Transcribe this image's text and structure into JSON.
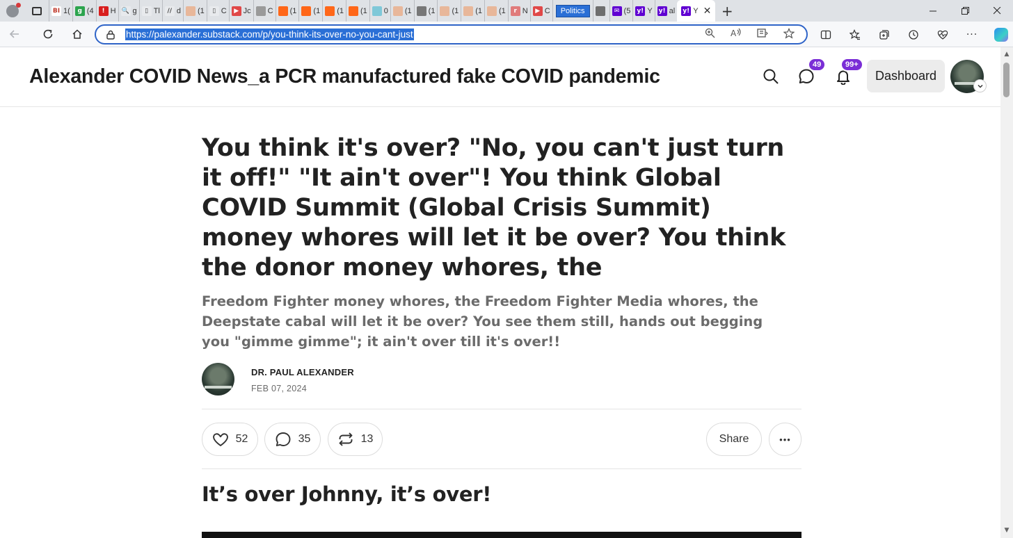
{
  "browser": {
    "tabs": [
      {
        "short": "1(",
        "fav_color": "#ffffff",
        "fav_text": "BI",
        "fav_fg": "#c0392b"
      },
      {
        "short": "(4",
        "fav_color": "#2ca44e",
        "fav_text": "g",
        "fav_fg": "#ffffff"
      },
      {
        "short": "H",
        "fav_color": "#d81e1e",
        "fav_text": "!",
        "fav_fg": "#ffffff"
      },
      {
        "short": "g",
        "fav_color": "#e8eaed",
        "fav_text": "🔍",
        "fav_fg": "#444444"
      },
      {
        "short": "Tl",
        "fav_color": "#e8eaed",
        "fav_text": "▯",
        "fav_fg": "#444444"
      },
      {
        "short": "d",
        "fav_color": "#e8eaed",
        "fav_text": "//",
        "fav_fg": "#444444"
      },
      {
        "short": "(1",
        "fav_color": "#e8b79a",
        "fav_text": "",
        "fav_fg": "#ffffff"
      },
      {
        "short": "C",
        "fav_color": "#e8eaed",
        "fav_text": "▯",
        "fav_fg": "#444444"
      },
      {
        "short": "Jc",
        "fav_color": "#e04848",
        "fav_text": "▶",
        "fav_fg": "#ffffff"
      },
      {
        "short": "C",
        "fav_color": "#9a9a9a",
        "fav_text": "",
        "fav_fg": "#ffffff"
      },
      {
        "short": "(1",
        "fav_color": "#ff6719",
        "fav_text": "",
        "fav_fg": "#ffffff"
      },
      {
        "short": "(1",
        "fav_color": "#ff6719",
        "fav_text": "",
        "fav_fg": "#ffffff"
      },
      {
        "short": "(1",
        "fav_color": "#ff6719",
        "fav_text": "",
        "fav_fg": "#ffffff"
      },
      {
        "short": "(1",
        "fav_color": "#ff6719",
        "fav_text": "",
        "fav_fg": "#ffffff"
      },
      {
        "short": "0",
        "fav_color": "#7fc8d8",
        "fav_text": "",
        "fav_fg": "#ffffff"
      },
      {
        "short": "(1",
        "fav_color": "#e8b79a",
        "fav_text": "",
        "fav_fg": "#ffffff"
      },
      {
        "short": "(1",
        "fav_color": "#777777",
        "fav_text": "",
        "fav_fg": "#ffffff"
      },
      {
        "short": "(1",
        "fav_color": "#e8b79a",
        "fav_text": "",
        "fav_fg": "#ffffff"
      },
      {
        "short": "(1",
        "fav_color": "#e8b79a",
        "fav_text": "",
        "fav_fg": "#ffffff"
      },
      {
        "short": "(1",
        "fav_color": "#e8b79a",
        "fav_text": "",
        "fav_fg": "#ffffff"
      },
      {
        "short": "N",
        "fav_color": "#e07b7b",
        "fav_text": "r",
        "fav_fg": "#ffffff"
      },
      {
        "short": "C",
        "fav_color": "#e04848",
        "fav_text": "▶",
        "fav_fg": "#ffffff"
      }
    ],
    "politics_tab": "Politics",
    "tabs_after": [
      {
        "short": "",
        "fav_color": "#6e6e6e",
        "fav_text": "",
        "fav_fg": "#ffffff"
      },
      {
        "short": "(5",
        "fav_color": "#6001d2",
        "fav_text": "✉",
        "fav_fg": "#ffffff"
      },
      {
        "short": "Y",
        "fav_color": "#6001d2",
        "fav_text": "y!",
        "fav_fg": "#ffffff"
      },
      {
        "short": "al",
        "fav_color": "#6001d2",
        "fav_text": "y!",
        "fav_fg": "#ffffff"
      }
    ],
    "active_tab": {
      "short": "Y",
      "close": "✕"
    },
    "new_tab": "+",
    "url": "https://palexander.substack.com/p/you-think-its-over-no-you-cant-just"
  },
  "site": {
    "publication_title": "Alexander COVID News_a PCR manufactured fake COVID pandemic",
    "messages_count": "49",
    "notifications_count": "99+",
    "dashboard_label": "Dashboard"
  },
  "post": {
    "title": "You think it's over? \"No, you can't just turn it off!\" \"It ain't over\"! You think Global COVID Summit (Global Crisis Summit) money whores will let it be over? You think the donor money whores, the",
    "subtitle": "Freedom Fighter money whores, the Freedom Fighter Media whores, the Deepstate cabal will let it be over? You see them still, hands out begging you \"gimme gimme\"; it ain't over till it's over!!",
    "author": "DR. PAUL ALEXANDER",
    "date": "FEB 07, 2024",
    "likes": "52",
    "comments": "35",
    "restacks": "13",
    "share_label": "Share",
    "more_label": "•••",
    "section_heading": "It’s over Johnny, it’s over!"
  }
}
